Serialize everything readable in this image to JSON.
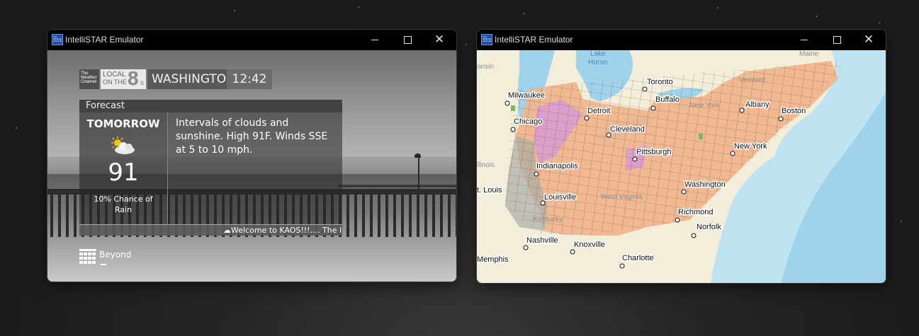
{
  "windows": [
    {
      "id": "left",
      "title": "IntelliSTAR Emulator",
      "controls": {
        "minimize": "minimize",
        "maximize": "maximize",
        "close": "✕"
      }
    },
    {
      "id": "right",
      "title": "IntelliSTAR Emulator",
      "controls": {
        "minimize": "minimize",
        "maximize": "maximize",
        "close": "✕"
      }
    }
  ],
  "left_app": {
    "brand": {
      "logo_text": "The Weather Channel",
      "local_line1": "LOCAL",
      "local_line2": "ON THE",
      "local_eight": "8",
      "local_s": "s",
      "city": "WASHINGTON",
      "time": "12:42"
    },
    "forecast": {
      "header": "Forecast",
      "day": "TOMORROW",
      "icon": "partly-sunny-icon",
      "temperature": "91",
      "rain_chance": "10% Chance of Rain",
      "description": "Intervals of clouds and sunshine. High 91F. Winds SSE at 5 to 10 mph."
    },
    "ticker": "☁Welcome to KAOS!!!.... The Intel",
    "beyond_label": "Beyond"
  },
  "right_app": {
    "cities": {
      "milwaukee": "Milwaukee",
      "chicago": "Chicago",
      "detroit": "Detroit",
      "toronto": "Toronto",
      "buffalo": "Buffalo",
      "albany": "Albany",
      "boston": "Boston",
      "cleveland": "Cleveland",
      "pittsburgh": "Pittsburgh",
      "new_york": "New York",
      "indianapolis": "Indianapolis",
      "st_louis": "t. Louis",
      "louisville": "Louisville",
      "washington": "Washington",
      "richmond": "Richmond",
      "norfolk": "Norfolk",
      "nashville": "Nashville",
      "knoxville": "Knoxville",
      "charlotte": "Charlotte",
      "memphis": "Memphis"
    },
    "regions": {
      "lake_huron_1": "Lake",
      "lake_huron_2": "Huron",
      "maine": "Maine",
      "vermont": "Vermont",
      "new_york_state": "New York",
      "west_virginia": "West Virginia",
      "kentucky": "Kentucky",
      "illinois": "llinois",
      "onsin": "onsin"
    },
    "colors": {
      "land": "#f3eed9",
      "water": "#bfe3f1",
      "deep_water": "#9fd3ec",
      "alert_orange": "#f0b48c",
      "alert_pink": "#d79ad4",
      "alert_gray": "#a9ada6"
    }
  }
}
